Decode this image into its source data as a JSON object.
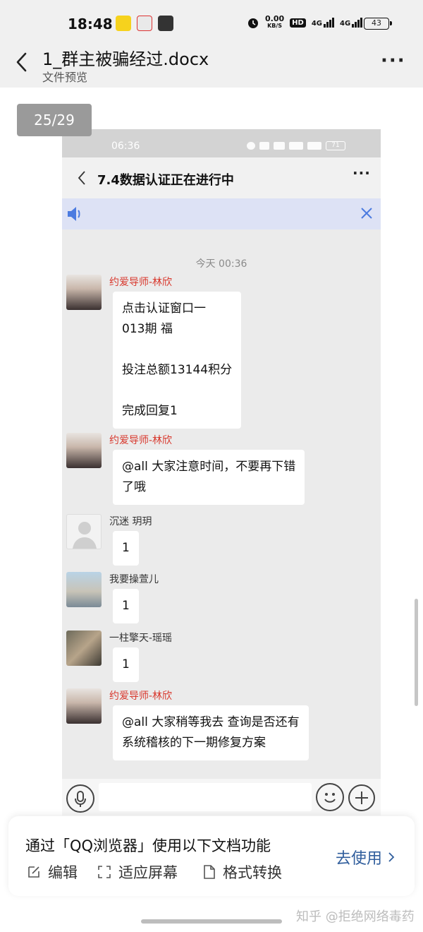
{
  "status_bar": {
    "time": "18:48",
    "net_speed": "0.00",
    "net_unit": "KB/S",
    "hd": "HD",
    "signal1": "4G",
    "signal2": "4G",
    "battery": "43"
  },
  "header": {
    "file_name": "1_群主被骗经过.docx",
    "subtitle": "文件预览"
  },
  "page_indicator": "25/29",
  "screenshot": {
    "status_time": "06:36",
    "battery": "71",
    "chat_title": "7.4数据认证正在进行中",
    "timestamp": "今天 00:36",
    "messages": [
      {
        "sender": "约爱导师-林欣",
        "text": "点击认证窗口一\n013期 福\n\n投注总额13144积分\n\n完成回复1"
      },
      {
        "sender": "约爱导师-林欣",
        "text": "@all 大家注意时间，不要再下错\n了哦"
      },
      {
        "sender": "沉迷 玥玥",
        "text": "1"
      },
      {
        "sender": "我要操萱儿",
        "text": "1"
      },
      {
        "sender": "一柱擎天-瑶瑶",
        "text": "1"
      },
      {
        "sender": "约爱导师-林欣",
        "text": "@all 大家稍等我去 查询是否还有\n系统稽核的下一期修复方案"
      }
    ]
  },
  "promo": {
    "title": "通过「QQ浏览器」使用以下文档功能",
    "features": [
      "编辑",
      "适应屏幕",
      "格式转换"
    ],
    "go_button": "去使用"
  },
  "watermark": "知乎 @拒绝网络毒药"
}
